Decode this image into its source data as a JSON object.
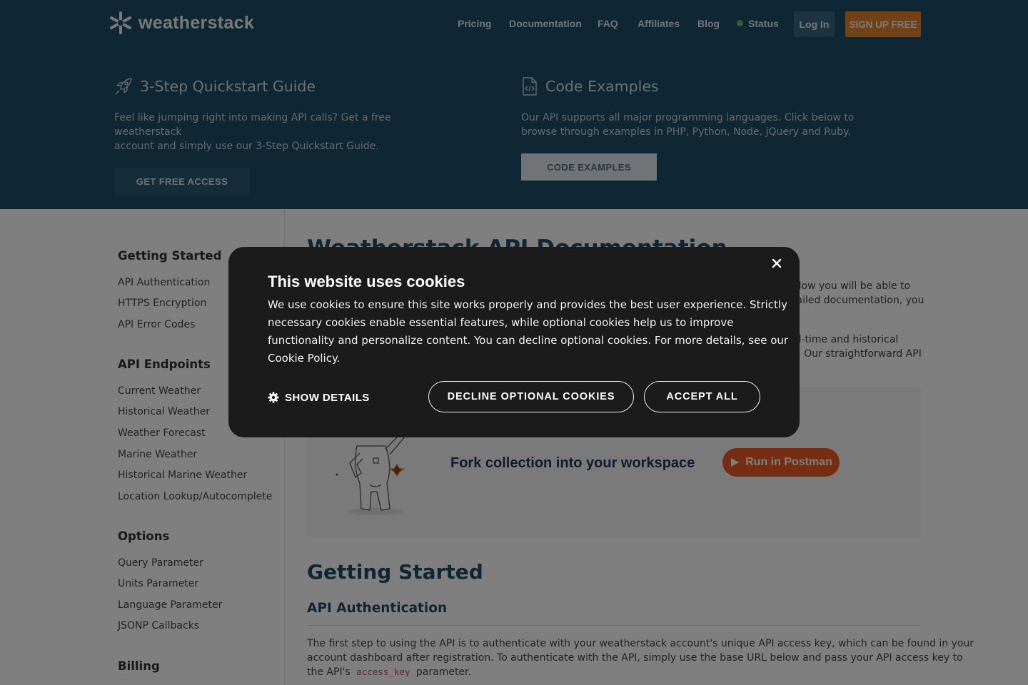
{
  "header": {
    "logo_text": "weatherstack",
    "nav": {
      "pricing": "Pricing",
      "documentation": "Documentation",
      "faq": "FAQ",
      "affiliates": "Affiliates",
      "blog": "Blog",
      "status": "Status"
    },
    "login_label": "Log In",
    "signup_label": "SIGN UP FREE",
    "colors": {
      "background": "#1f4d6b",
      "signup": "#e4822d",
      "status_dot": "#5fbf5a"
    }
  },
  "hero": {
    "quickstart": {
      "icon": "rocket-icon",
      "title": "3-Step Quickstart Guide",
      "desc_lines": [
        "Feel like jumping right into making API calls? Get a free weatherstack",
        "account and simply use our 3-Step Quickstart Guide."
      ],
      "button": "GET FREE ACCESS"
    },
    "code": {
      "icon": "code-file-icon",
      "title": "Code Examples",
      "desc_lines": [
        "Our API supports all major programming languages. Click below to",
        "browse through examples in PHP, Python, Node, jQuery and Ruby."
      ],
      "button": "CODE EXAMPLES"
    }
  },
  "sidebar": {
    "sections": [
      {
        "title": "Getting Started",
        "items": [
          "API Authentication",
          "HTTPS Encryption",
          "API Error Codes"
        ]
      },
      {
        "title": "API Endpoints",
        "items": [
          "Current Weather",
          "Historical Weather",
          "Weather Forecast",
          "Marine Weather",
          "Historical Marine Weather",
          "Location Lookup/Autocomplete"
        ]
      },
      {
        "title": "Options",
        "items": [
          "Query Parameter",
          "Units Parameter",
          "Language Parameter",
          "JSONP Callbacks"
        ]
      },
      {
        "title": "Billing",
        "items": []
      }
    ]
  },
  "main": {
    "title": "Weatherstack API Documentation",
    "intro_lines": [
      "elow you will be able to",
      "tailed documentation, you"
    ],
    "intro2_lines": [
      "al-time and historical",
      "s. Our straightforward API"
    ],
    "postman": {
      "text": "Fork collection into your workspace",
      "button": "Run in Postman",
      "button_color": "#ef5b25"
    },
    "getting_started": "Getting Started",
    "api_auth": "API Authentication",
    "auth_lines": [
      "The first step to using the API is to authenticate with your weatherstack account's unique API access key, which can be found in your",
      "account dashboard after registration. To authenticate with the API, simply use the base URL below and pass your API access key to"
    ],
    "auth_line3_before": "the API's",
    "auth_code": "access_key",
    "auth_line3_after": "parameter."
  },
  "cookie": {
    "title": "This website uses cookies",
    "body_lines": [
      "We use cookies to ensure this site works properly and provides the best user experience. Strictly",
      "necessary cookies enable essential features, while optional cookies help us to improve",
      "functionality and personalize content. You can decline optional cookies. For more details, see our",
      "Cookie Policy."
    ],
    "show_details": "SHOW DETAILS",
    "decline": "DECLINE OPTIONAL COOKIES",
    "accept": "ACCEPT ALL"
  }
}
